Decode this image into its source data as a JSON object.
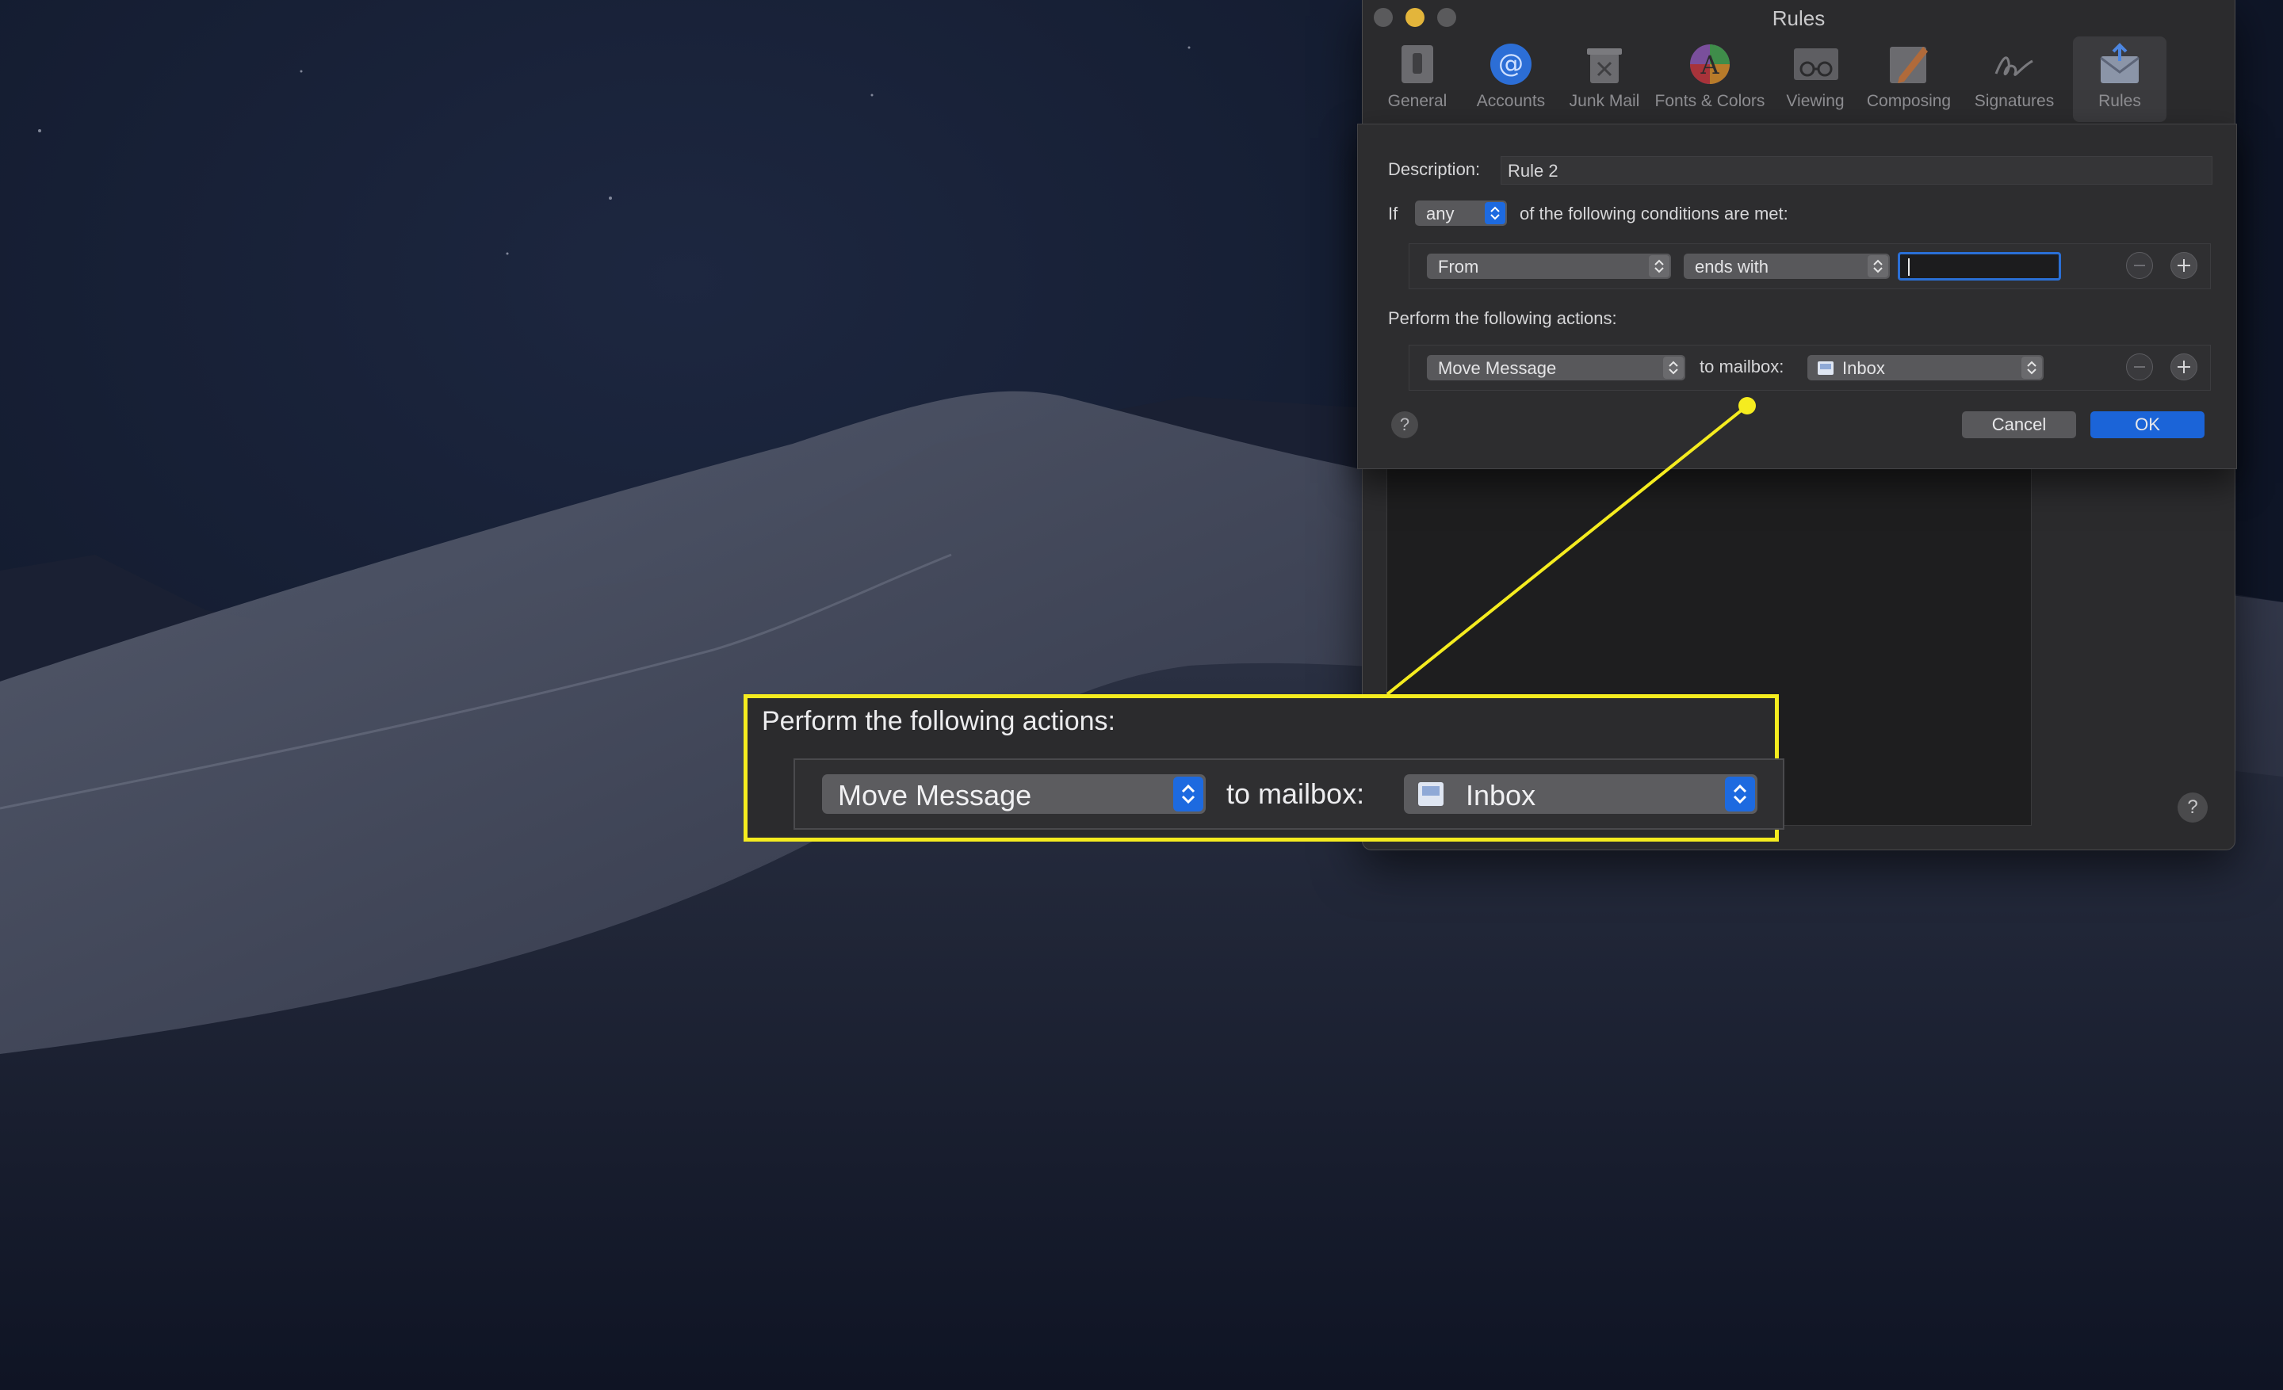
{
  "window": {
    "title": "Rules",
    "toolbar": [
      {
        "label": "General",
        "icon": "switch-icon"
      },
      {
        "label": "Accounts",
        "icon": "at-icon"
      },
      {
        "label": "Junk Mail",
        "icon": "trash-icon"
      },
      {
        "label": "Fonts & Colors",
        "icon": "color-wheel-icon"
      },
      {
        "label": "Viewing",
        "icon": "glasses-icon"
      },
      {
        "label": "Composing",
        "icon": "pencil-icon"
      },
      {
        "label": "Signatures",
        "icon": "signature-icon"
      },
      {
        "label": "Rules",
        "icon": "envelope-icon",
        "active": true
      }
    ],
    "help": "?"
  },
  "sheet": {
    "description_label": "Description:",
    "description_value": "Rule 2",
    "if_label": "If",
    "match_popup": "any",
    "conditions_text": "of the following conditions are met:",
    "condition": {
      "field": "From",
      "operator": "ends with",
      "value": ""
    },
    "actions_label": "Perform the following actions:",
    "action": {
      "type": "Move Message",
      "to_label": "to mailbox:",
      "mailbox": "Inbox"
    },
    "help": "?",
    "cancel_label": "Cancel",
    "ok_label": "OK"
  },
  "callout": {
    "heading": "Perform the following actions:",
    "action": "Move Message",
    "to_label": "to mailbox:",
    "mailbox": "Inbox",
    "color": "#f5ec1f"
  },
  "colors": {
    "accent_blue": "#1d6ae0",
    "callout_yellow": "#f5ec1f",
    "traffic_yellow": "#e3b53b"
  }
}
